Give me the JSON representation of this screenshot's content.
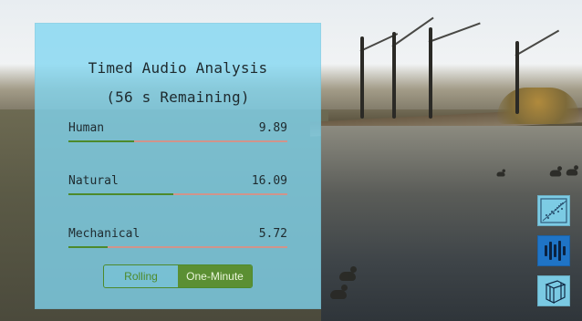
{
  "panel": {
    "title_line1": "Timed Audio Analysis",
    "title_line2": "(56 s Remaining)",
    "metrics": [
      {
        "label": "Human",
        "value": "9.89",
        "level_percent": 30
      },
      {
        "label": "Natural",
        "value": "16.09",
        "level_percent": 48
      },
      {
        "label": "Mechanical",
        "value": "5.72",
        "level_percent": 18
      }
    ],
    "mode_toggle": {
      "options": [
        "Rolling",
        "One-Minute"
      ],
      "selected": "One-Minute"
    }
  },
  "side_buttons": {
    "scatter": {
      "icon": "scatter-plot-icon"
    },
    "audio": {
      "icon": "audio-bars-icon",
      "selected": true
    },
    "cube": {
      "icon": "3d-cube-icon"
    }
  },
  "colors": {
    "panel_bg": "#80D6F1",
    "accent_green": "#5B8F33",
    "track": "#D69187",
    "active_blue": "#1F74C6"
  }
}
